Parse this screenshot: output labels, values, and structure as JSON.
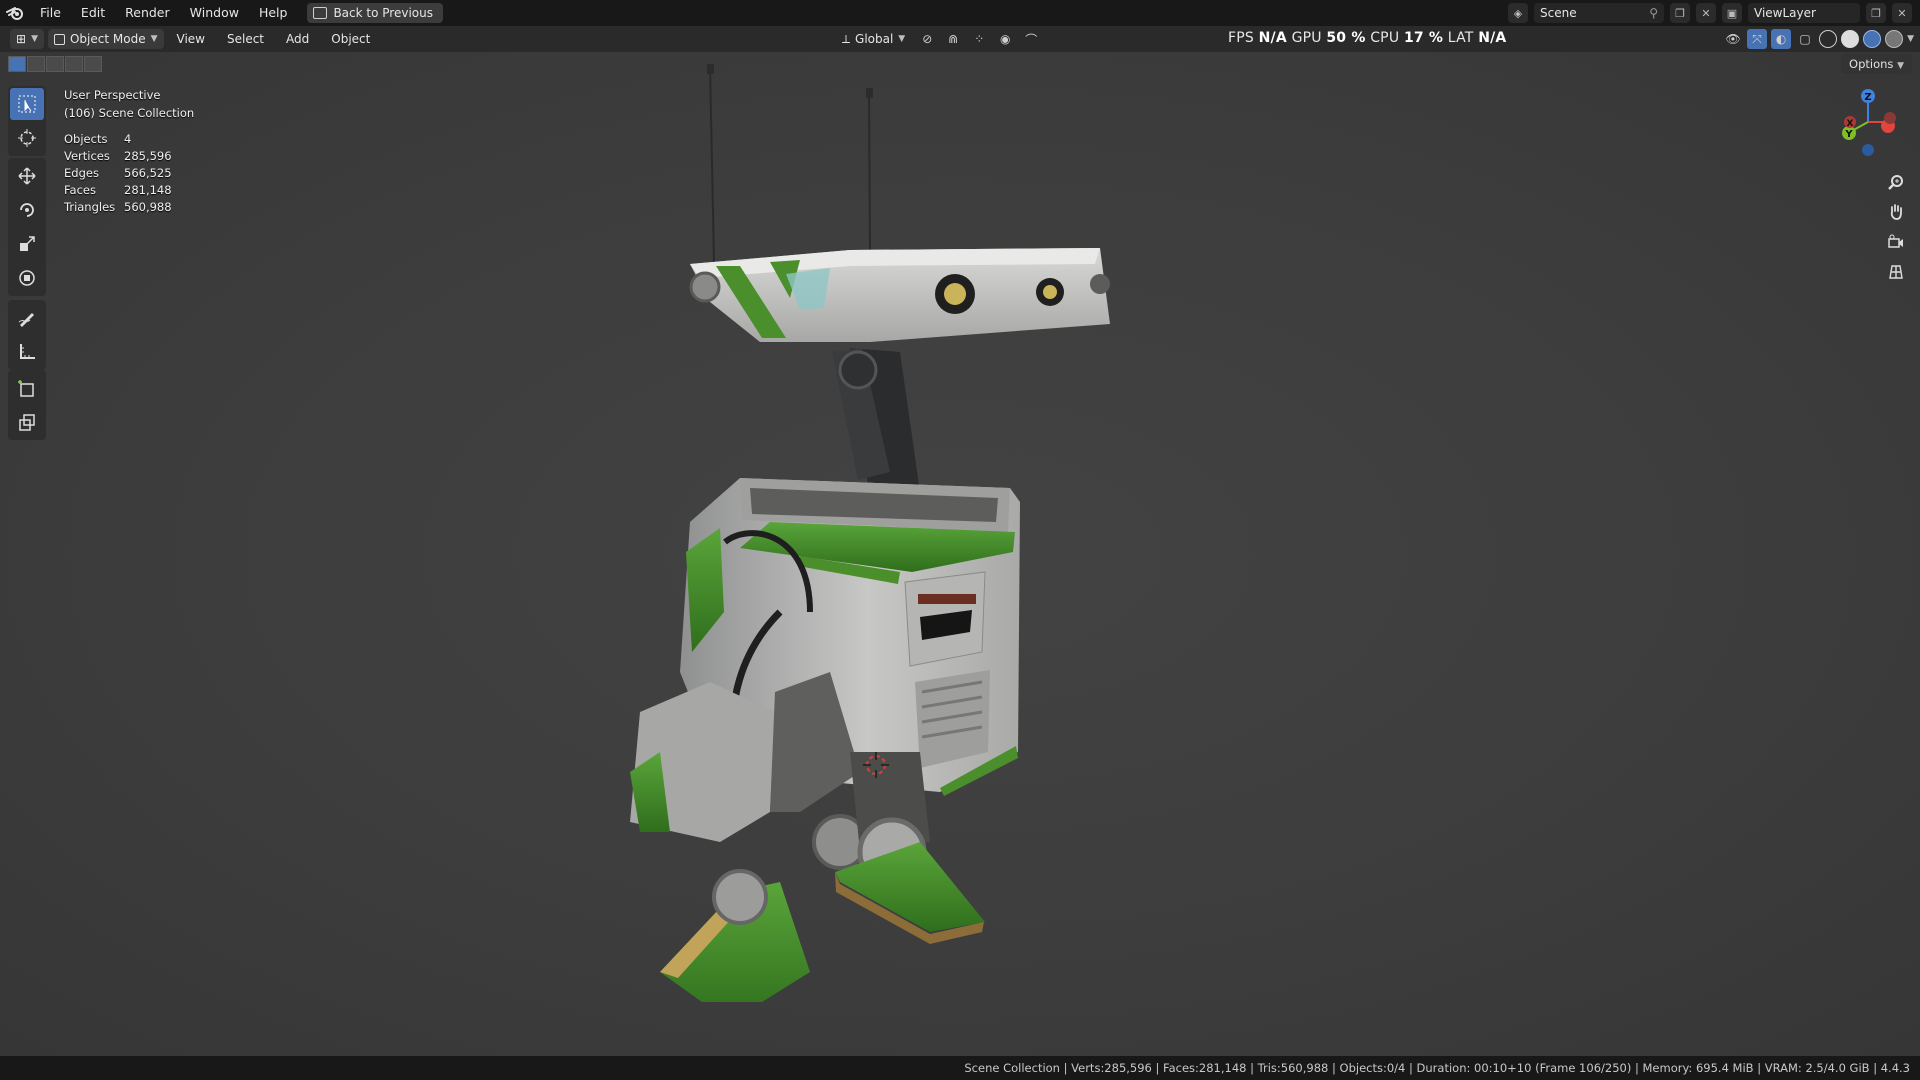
{
  "topbar": {
    "menus": [
      "File",
      "Edit",
      "Render",
      "Window",
      "Help"
    ],
    "back_button": "Back to Previous",
    "scene_name": "Scene",
    "view_layer": "ViewLayer"
  },
  "viewport_header": {
    "mode": "Object Mode",
    "menus": [
      "View",
      "Select",
      "Add",
      "Object"
    ],
    "transform_orientation": "Global",
    "perf": {
      "fps_label": "FPS",
      "fps_value": "N/A",
      "gpu_label": "GPU",
      "gpu_value": "50 %",
      "cpu_label": "CPU",
      "cpu_value": "17 %",
      "lat_label": "LAT",
      "lat_value": "N/A"
    },
    "options": "Options"
  },
  "overlay": {
    "view_name": "User Perspective",
    "collection": "(106) Scene Collection"
  },
  "stats": [
    {
      "label": "Objects",
      "value": "4"
    },
    {
      "label": "Vertices",
      "value": "285,596"
    },
    {
      "label": "Edges",
      "value": "566,525"
    },
    {
      "label": "Faces",
      "value": "281,148"
    },
    {
      "label": "Triangles",
      "value": "560,988"
    }
  ],
  "gizmo": {
    "x": "X",
    "y": "Y",
    "z": "Z"
  },
  "statusbar": {
    "text": "Scene Collection | Verts:285,596 | Faces:281,148 | Tris:560,988 | Objects:0/4 | Duration: 00:10+10 (Frame 106/250) | Memory: 695.4 MiB | VRAM: 2.5/4.0 GiB | 4.4.3"
  },
  "colors": {
    "accent": "#4772b3",
    "robot_green": "#3f8f2a",
    "axis_x": "#e2443e",
    "axis_y": "#7fbf28",
    "axis_z": "#3f82e0"
  },
  "tools": [
    "select-box",
    "cursor",
    "move",
    "rotate",
    "scale",
    "transform",
    "annotate",
    "measure",
    "add-cube",
    "extrude"
  ]
}
